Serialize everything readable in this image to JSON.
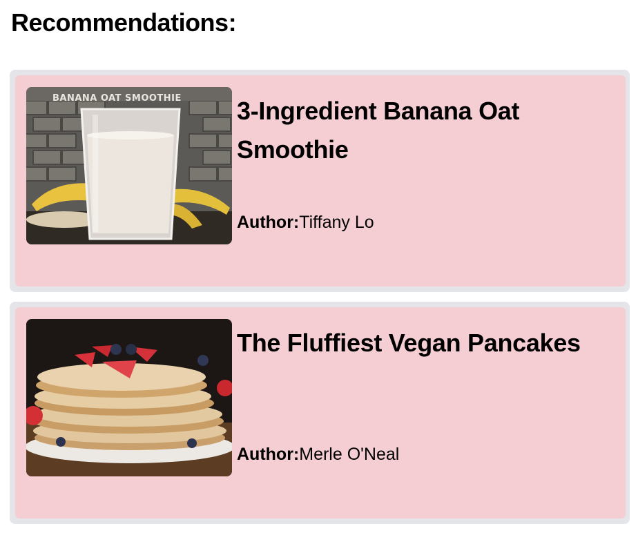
{
  "page": {
    "heading": "Recommendations:"
  },
  "recommendations": [
    {
      "title": "3-Ingredient Banana Oat Smoothie",
      "author_label": "Author:",
      "author": "Tiffany Lo",
      "image_caption": "BANANA OAT SMOOTHIE"
    },
    {
      "title": "The Fluffiest Vegan Pancakes",
      "author_label": "Author:",
      "author": "Merle O'Neal"
    }
  ],
  "colors": {
    "card_background": "#f5ced3",
    "card_border": "#e4e5e9"
  }
}
